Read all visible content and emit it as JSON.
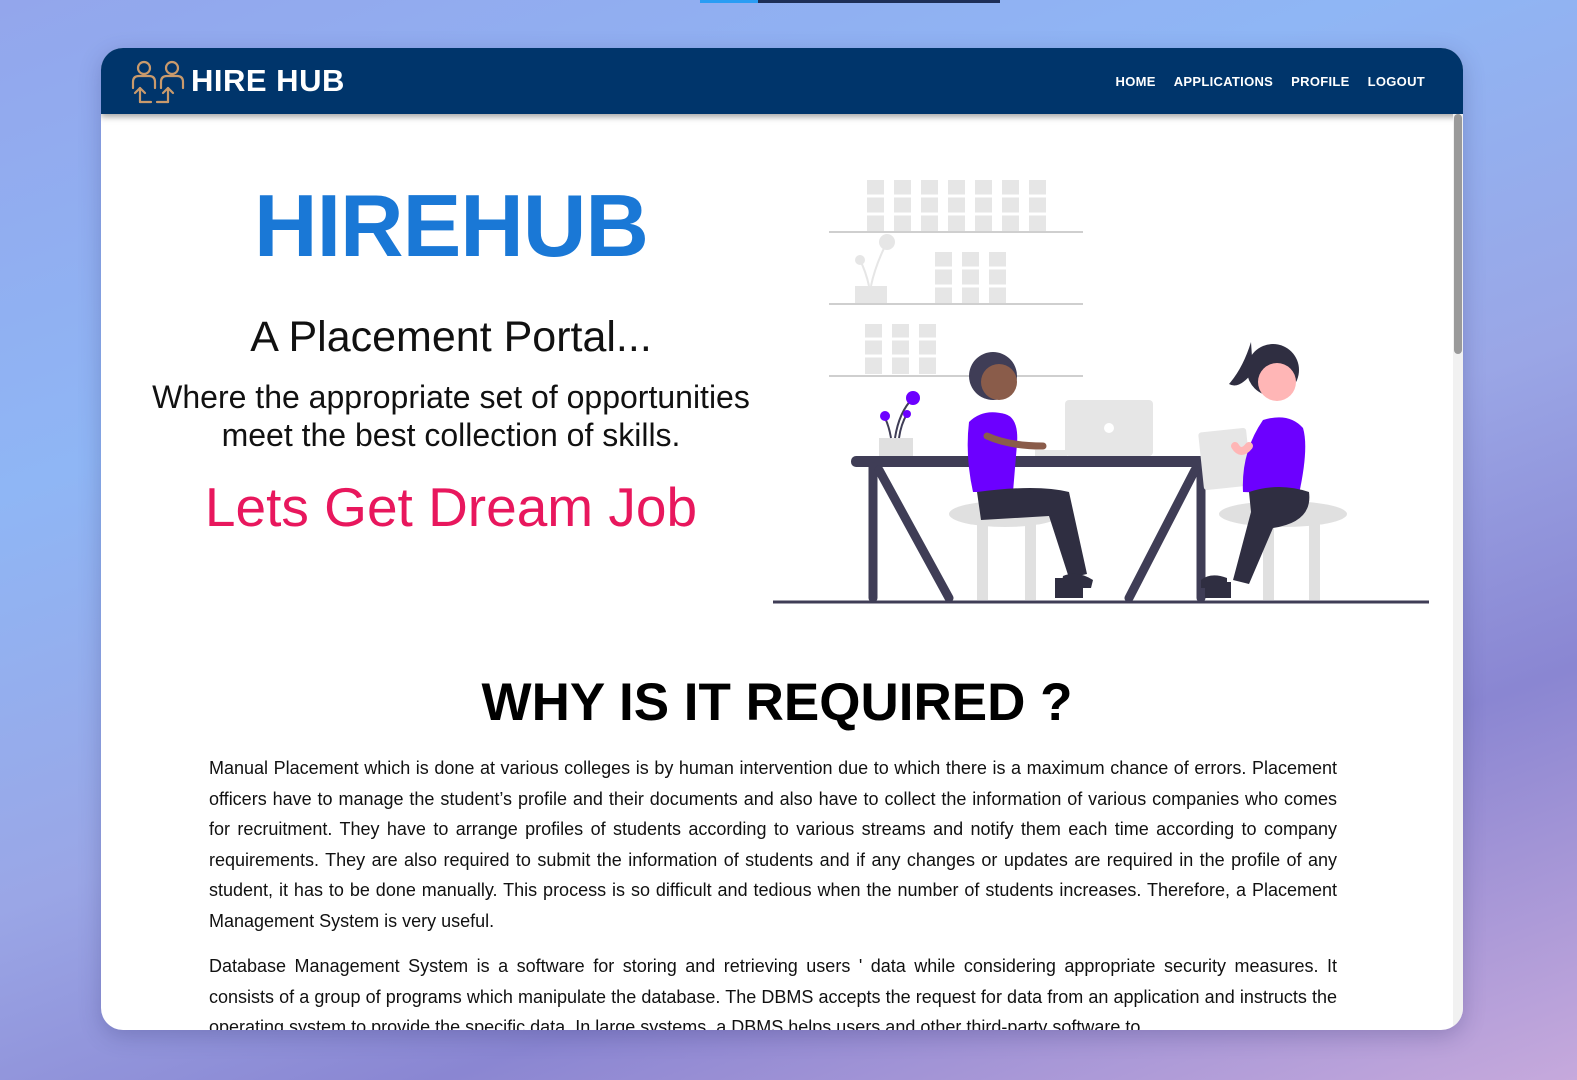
{
  "navbar": {
    "brand": "HIRE HUB",
    "links": [
      "HOME",
      "APPLICATIONS",
      "PROFILE",
      "LOGOUT"
    ]
  },
  "hero": {
    "title": "HIREHUB",
    "subtitle": "A Placement Portal...",
    "description": "Where the appropriate set of opportunities meet the best collection of skills.",
    "cta": "Lets Get Dream Job"
  },
  "section": {
    "title": "WHY IS IT REQUIRED ?",
    "paragraphs": [
      "Manual Placement which is done at various colleges is by human intervention due to which there is a maximum chance of errors. Placement officers have to manage the student’s profile and their documents and also have to collect the information of various companies who comes for recruitment. They have to arrange profiles of students according to various streams and notify them each time according to company requirements. They are also required to submit the information of students and if any changes or updates are required in the profile of any student, it has to be done manually. This process is so difficult and tedious when the number of students increases. Therefore, a Placement Management System is very useful.",
      "Database Management System is a software for storing and retrieving users ' data while considering appropriate security measures. It consists of a group of programs which manipulate the database. The DBMS accepts the request for data from an application and instructs the operating system to provide the specific data. In large systems, a DBMS helps users and other third-party software to"
    ]
  },
  "icons": {
    "brand": "people-arrows-icon",
    "illustration": "two-people-working-at-desk-illustration"
  },
  "colors": {
    "navbar": "#00356b",
    "title_blue": "#1a78d6",
    "cta_pink": "#e8175d",
    "accent_purple": "#6c00ff"
  }
}
